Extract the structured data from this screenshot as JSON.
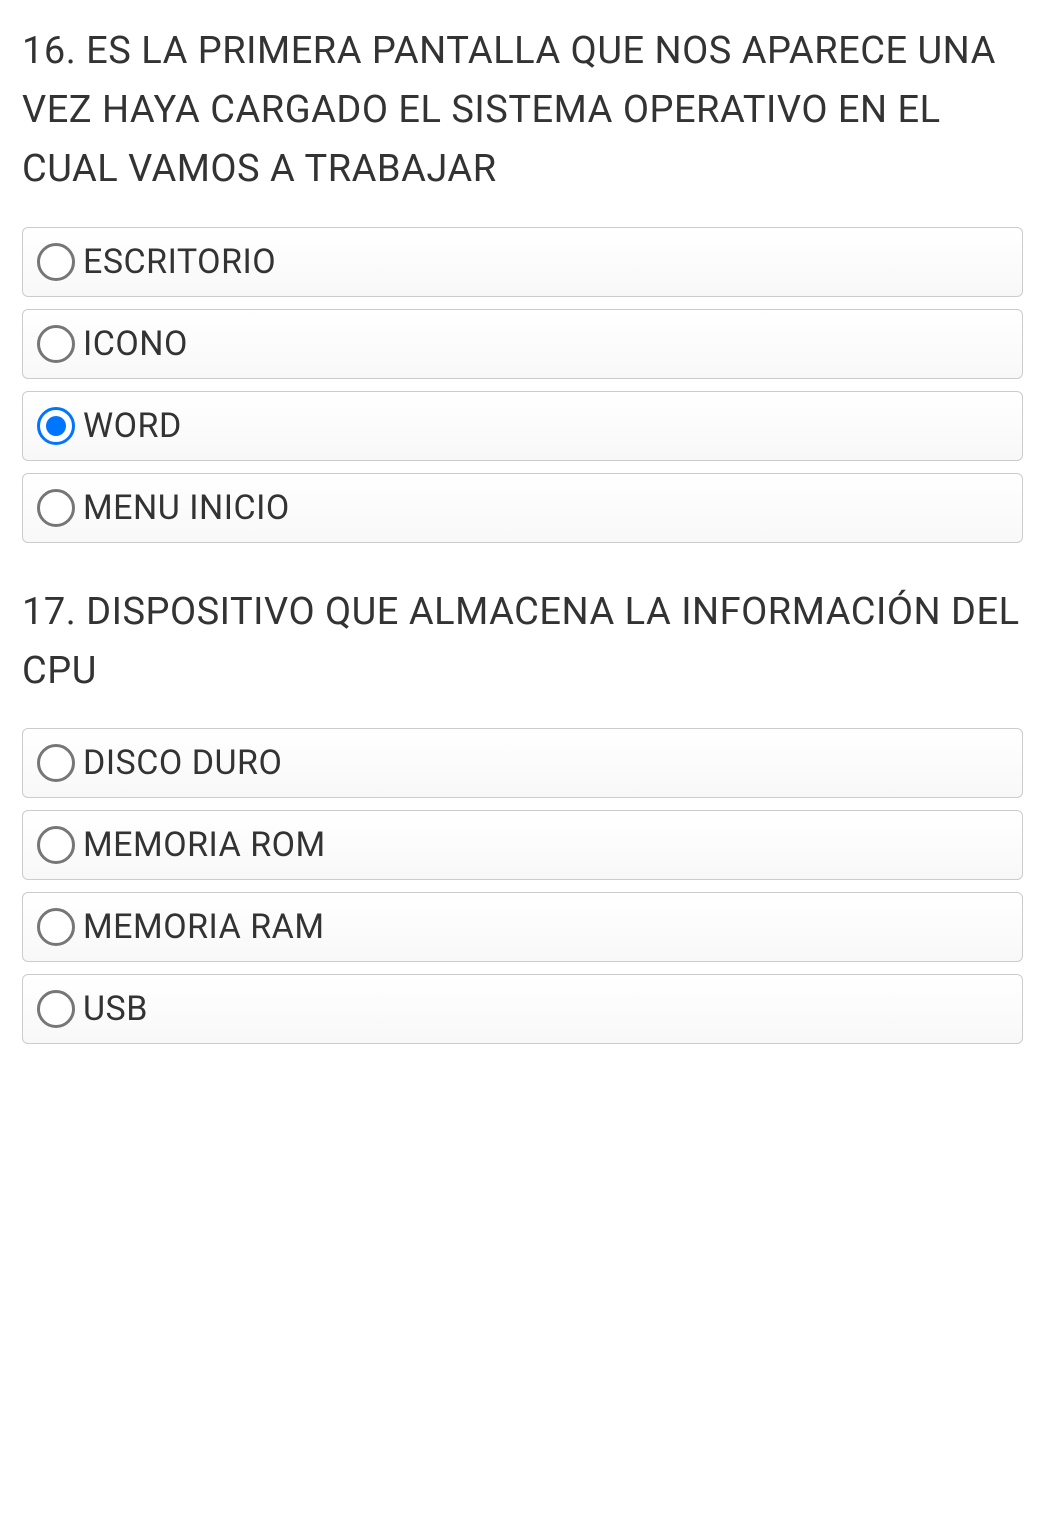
{
  "questions": [
    {
      "number": "16.",
      "text": "ES LA PRIMERA PANTALLA QUE NOS APARECE UNA VEZ HAYA CARGADO EL SISTEMA OPERATIVO EN EL CUAL VAMOS A TRABAJAR",
      "options": [
        {
          "label": "ESCRITORIO",
          "checked": false
        },
        {
          "label": "ICONO",
          "checked": false
        },
        {
          "label": "WORD",
          "checked": true
        },
        {
          "label": "MENU INICIO",
          "checked": false
        }
      ]
    },
    {
      "number": "17.",
      "text": "DISPOSITIVO QUE ALMACENA LA INFORMACIÓN DEL CPU",
      "options": [
        {
          "label": "DISCO DURO",
          "checked": false
        },
        {
          "label": "MEMORIA ROM",
          "checked": false
        },
        {
          "label": "MEMORIA RAM",
          "checked": false
        },
        {
          "label": "USB",
          "checked": false
        }
      ]
    }
  ]
}
